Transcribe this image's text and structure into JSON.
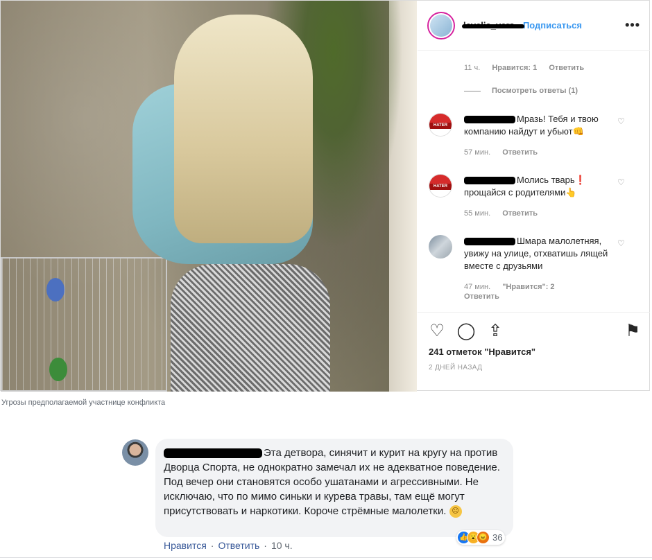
{
  "instagram": {
    "username": "levelia_vers",
    "separator": "•",
    "follow_label": "Подписаться",
    "more_label": "•••",
    "first_comment_meta": {
      "time": "11 ч.",
      "likes": "Нравится: 1",
      "reply": "Ответить"
    },
    "view_replies": "Посмотреть ответы (1)",
    "comments": [
      {
        "text": "Мразь! Тебя и твою компанию найдут и убьют👊",
        "time": "57 мин.",
        "reply": "Ответить",
        "avatar": "hater"
      },
      {
        "text": "Молись тварь❗ прощайся с родителями👆",
        "time": "55 мин.",
        "reply": "Ответить",
        "avatar": "hater"
      },
      {
        "text": "Шмара малолетняя, увижу на улице, отхватишь лящей вместе с друзьями",
        "time": "47 мин.",
        "likes": "\"Нравится\": 2",
        "reply": "Ответить",
        "avatar": "photo"
      }
    ],
    "hater_badge": "HATER",
    "likes_total": "241 отметок \"Нравится\"",
    "date": "2 ДНЕЙ НАЗАД",
    "icons": {
      "like": "heart-icon",
      "comment": "comment-icon",
      "share": "share-icon",
      "save": "bookmark-icon"
    }
  },
  "caption": "Угрозы предполагаемой участнице конфликта",
  "facebook": {
    "comment_text": "Эта детвора, синячит и курит на кругу на против Дворца Спорта, не однократно замечал их не адекватное поведение. Под вечер они становятся особо ушатанами и агрессивными. Не исключаю, что по мимо синьки и курева травы, там ещё могут присутствовать и наркотики. Короче стрёмные малолетки.",
    "actions": {
      "like": "Нравится",
      "reply": "Ответить",
      "time": "10 ч.",
      "separator": "·"
    },
    "reaction_count": "36"
  }
}
